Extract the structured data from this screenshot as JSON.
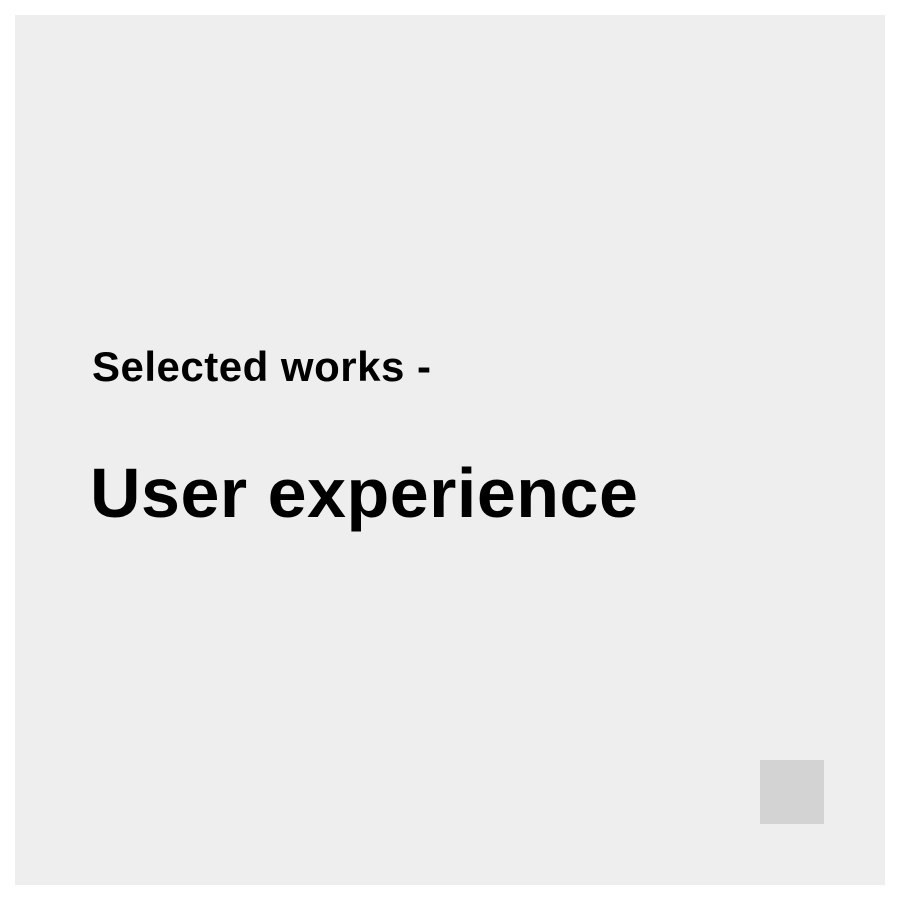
{
  "card": {
    "eyebrow": "Selected works -",
    "headline": "User experience"
  },
  "colors": {
    "background": "#ffffff",
    "card": "#eeeeee",
    "text": "#000000",
    "corner_square": "#d3d3d3"
  }
}
